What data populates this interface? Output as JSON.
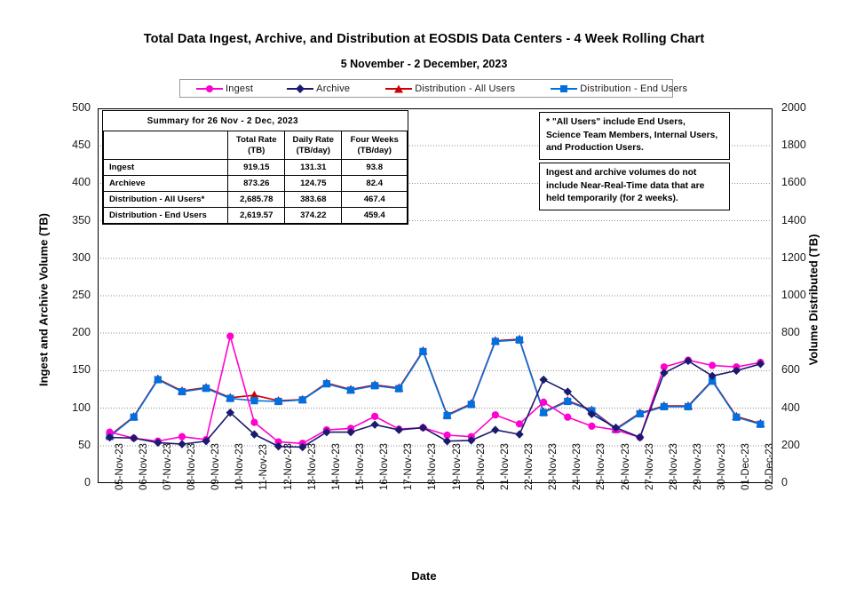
{
  "title": "Total Data Ingest, Archive, and  Distribution at EOSDIS Data Centers - 4 Week Rolling Chart",
  "subtitle": "5  November  -  2  December,  2023",
  "axis": {
    "xlabel": "Date",
    "ylabel_left": "Ingest and Archive Volume (TB)",
    "ylabel_right": "Volume Distributed (TB)"
  },
  "legend": [
    {
      "label": "Ingest",
      "color": "#FF00D0",
      "marker": "circle"
    },
    {
      "label": "Archive",
      "color": "#1A1A6E",
      "marker": "diamond"
    },
    {
      "label": "Distribution - All Users",
      "color": "#CC0000",
      "marker": "triangle"
    },
    {
      "label": "Distribution - End Users",
      "color": "#0070E0",
      "marker": "square"
    }
  ],
  "summary": {
    "heading": "Summary for  26  Nov  -  2 Dec,  2023",
    "columns": [
      "",
      "Total Rate\n(TB)",
      "Daily Rate\n(TB/day)",
      "Four Weeks\n(TB/day)"
    ],
    "col_headers": [
      {
        "line1": "Total Rate",
        "line2": "(TB)"
      },
      {
        "line1": "Daily Rate",
        "line2": "(TB/day)"
      },
      {
        "line1": "Four Weeks",
        "line2": "(TB/day)"
      }
    ],
    "rows": [
      {
        "label": "Ingest",
        "total_rate": "919.15",
        "daily_rate": "131.31",
        "four_weeks": "93.8"
      },
      {
        "label": "Archieve",
        "total_rate": "873.26",
        "daily_rate": "124.75",
        "four_weeks": "82.4"
      },
      {
        "label": "Distribution - All Users*",
        "total_rate": "2,685.78",
        "daily_rate": "383.68",
        "four_weeks": "467.4"
      },
      {
        "label": "Distribution - End Users",
        "total_rate": "2,619.57",
        "daily_rate": "374.22",
        "four_weeks": "459.4"
      }
    ]
  },
  "notes": [
    {
      "lines": [
        "  * \"All Users\" include End Users,",
        "Science Team Members,  Internal Users,",
        "and Production Users."
      ]
    },
    {
      "lines": [
        "Ingest and archive volumes do not",
        "include Near-Real-Time data that are",
        "held temporarily (for 2 weeks)."
      ]
    }
  ],
  "chart_data": {
    "type": "line",
    "title": "Total Data Ingest, Archive, and  Distribution at EOSDIS Data Centers - 4 Week Rolling Chart",
    "subtitle": "5  November  -  2  December,  2023",
    "xlabel": "Date",
    "ylabel": "Ingest and Archive Volume (TB)",
    "ylabel_secondary": "Volume Distributed (TB)",
    "ylim": [
      0,
      500
    ],
    "ytick_step": 50,
    "yticks": [
      0,
      50,
      100,
      150,
      200,
      250,
      300,
      350,
      400,
      450,
      500
    ],
    "ylim_secondary": [
      0,
      2000
    ],
    "ytick_step_secondary": 200,
    "yticks_secondary": [
      0,
      200,
      400,
      600,
      800,
      1000,
      1200,
      1400,
      1600,
      1800,
      2000
    ],
    "grid": true,
    "legend_position": "top",
    "categories": [
      "05-Nov-23",
      "06-Nov-23",
      "07-Nov-23",
      "08-Nov-23",
      "09-Nov-23",
      "10-Nov-23",
      "11-Nov-23",
      "12-Nov-23",
      "13-Nov-23",
      "14-Nov-23",
      "15-Nov-23",
      "16-Nov-23",
      "17-Nov-23",
      "18-Nov-23",
      "19-Nov-23",
      "20-Nov-23",
      "21-Nov-23",
      "22-Nov-23",
      "23-Nov-23",
      "24-Nov-23",
      "25-Nov-23",
      "26-Nov-23",
      "27-Nov-23",
      "28-Nov-23",
      "29-Nov-23",
      "30-Nov-23",
      "01-Dec-23",
      "02-Dec-23"
    ],
    "series": [
      {
        "name": "Ingest",
        "axis": "left",
        "units": "TB",
        "color": "#FF00D0",
        "marker": "circle",
        "values": [
          68,
          60,
          56,
          62,
          58,
          196,
          81,
          55,
          53,
          71,
          73,
          89,
          72,
          74,
          64,
          62,
          91,
          79,
          108,
          88,
          76,
          71,
          61,
          155,
          164,
          157,
          155,
          161
        ]
      },
      {
        "name": "Archive",
        "axis": "left",
        "units": "TB",
        "color": "#1A1A6E",
        "marker": "diamond",
        "values": [
          61,
          60,
          54,
          52,
          56,
          94,
          65,
          49,
          48,
          68,
          68,
          78,
          71,
          74,
          56,
          57,
          71,
          65,
          138,
          122,
          92,
          74,
          61,
          147,
          163,
          143,
          150,
          159
        ]
      },
      {
        "name": "Distribution - All Users",
        "axis": "right",
        "units": "TB",
        "color": "#CC0000",
        "marker": "triangle",
        "values": [
          254,
          355,
          556,
          492,
          510,
          456,
          469,
          440,
          446,
          534,
          500,
          524,
          508,
          706,
          364,
          424,
          760,
          768,
          380,
          440,
          390,
          290,
          374,
          412,
          412,
          548,
          356,
          318
        ]
      },
      {
        "name": "Distribution - End Users",
        "axis": "right",
        "units": "TB",
        "color": "#0070E0",
        "marker": "square",
        "values": [
          249,
          352,
          552,
          488,
          506,
          452,
          440,
          436,
          444,
          530,
          496,
          520,
          504,
          702,
          360,
          420,
          756,
          764,
          376,
          436,
          386,
          286,
          370,
          408,
          408,
          544,
          352,
          314
        ]
      }
    ]
  }
}
